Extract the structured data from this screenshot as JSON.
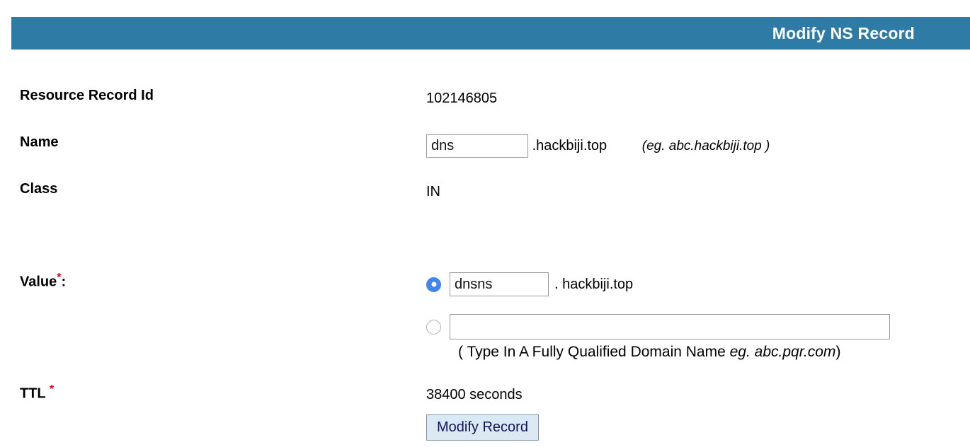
{
  "header": {
    "title": "Modify NS Record",
    "bar_color": "#2e7ba6",
    "title_color": "#ffffff"
  },
  "form": {
    "resource_record_id": {
      "label": "Resource Record Id",
      "value": "102146805"
    },
    "name": {
      "label": "Name",
      "input_value": "dns",
      "input_placeholder": "",
      "domain_suffix": ".hackbiji.top",
      "example": "(eg. abc.hackbiji.top )"
    },
    "class": {
      "label": "Class",
      "value": "IN"
    },
    "value": {
      "label": "Value",
      "required_marker": "*",
      "colon": ":",
      "option_1": {
        "radio_state": "checked",
        "input_value": "dnsns",
        "input_placeholder": "",
        "domain_suffix": ". hackbiji.top"
      },
      "option_2": {
        "radio_state": "unchecked",
        "input_value": "",
        "input_placeholder": "",
        "hint_prefix": "( Type In A Fully Qualified Domain Name ",
        "hint_example": "eg. abc.pqr.com",
        "hint_suffix": ")"
      }
    },
    "ttl": {
      "label": "TTL",
      "required_marker": "*",
      "value": "38400 seconds"
    },
    "submit": {
      "label": "Modify Record"
    }
  },
  "colors": {
    "header_blue": "#2e7ba6",
    "required_red": "#d0021b",
    "radio_blue": "#3f86ee",
    "button_bg": "#dce8f2",
    "button_text": "#11135c"
  }
}
